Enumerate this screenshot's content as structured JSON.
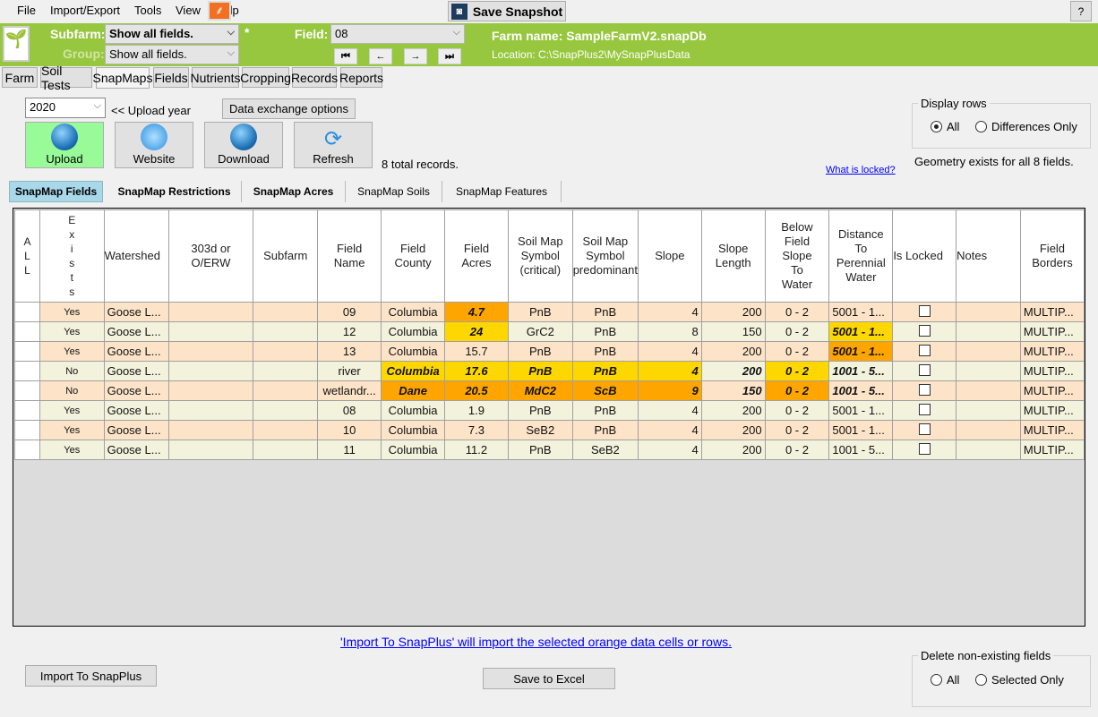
{
  "menu": [
    "File",
    "Import/Export",
    "Tools",
    "View",
    "Help"
  ],
  "snapshot_label": "Save Snapshot",
  "help_label": "?",
  "header": {
    "subfarm_label": "Subfarm:",
    "subfarm_value": "Show all fields.",
    "group_label": "Group:",
    "group_value": "Show all fields.",
    "asterisk": "*",
    "field_label": "Field:",
    "field_value": "08",
    "farm_name": "Farm name: SampleFarmV2.snapDb",
    "location": "Location: C:\\SnapPlus2\\MySnapPlusData",
    "nav": [
      "⏮",
      "←",
      "→",
      "⏭"
    ]
  },
  "tabs": [
    "Farm",
    "Soil Tests",
    "SnapMaps",
    "Fields",
    "Nutrients",
    "Cropping",
    "Records",
    "Reports"
  ],
  "active_tab": "SnapMaps",
  "year": "2020",
  "upload_year_label": "<< Upload year",
  "data_exchange_label": "Data exchange options",
  "actions": [
    "Upload",
    "Website",
    "Download",
    "Refresh"
  ],
  "total_records": "8 total records.",
  "what_locked": "What is locked?",
  "display_rows": {
    "title": "Display rows",
    "options": [
      "All",
      "Differences Only"
    ],
    "selected": "All"
  },
  "geometry_text": "Geometry exists for all 8 fields.",
  "subtabs": [
    "SnapMap Fields",
    "SnapMap Restrictions",
    "SnapMap Acres",
    "SnapMap Soils",
    "SnapMap Features"
  ],
  "active_subtab": "SnapMap Fields",
  "colors": {
    "orange": "#ffa500",
    "yellow": "#ffd700",
    "row_odd": "#fde4c8",
    "row_even": "#f3f2dd",
    "header_green": "#97c73e"
  },
  "table": {
    "columns": [
      "A\nL\nL",
      "E\nx\ni\ns\nt\ns",
      "Watershed",
      "303d or\nO/ERW",
      "Subfarm",
      "Field\nName",
      "Field\nCounty",
      "Field\nAcres",
      "Soil Map\nSymbol\n(critical)",
      "Soil Map\nSymbol\npredominant",
      "Slope",
      "Slope\nLength",
      "Below\nField\nSlope\nTo\nWater",
      "Distance\nTo\nPerennial\nWater",
      "Is Locked",
      "Notes",
      "Field\nBorders"
    ],
    "rows": [
      {
        "cells": [
          "",
          "Yes",
          "Goose L...",
          "",
          "",
          "09",
          "Columbia",
          "4.7",
          "PnB",
          "PnB",
          "4",
          "200",
          "0 - 2",
          "5001 - 1...",
          "",
          "",
          "MULTIP..."
        ],
        "hl": {
          "7": "o"
        }
      },
      {
        "cells": [
          "",
          "Yes",
          "Goose L...",
          "",
          "",
          "12",
          "Columbia",
          "24",
          "GrC2",
          "PnB",
          "8",
          "150",
          "0 - 2",
          "5001 - 1...",
          "",
          "",
          "MULTIP..."
        ],
        "hl": {
          "7": "y",
          "13": "y"
        }
      },
      {
        "cells": [
          "",
          "Yes",
          "Goose L...",
          "",
          "",
          "13",
          "Columbia",
          "15.7",
          "PnB",
          "PnB",
          "4",
          "200",
          "0 - 2",
          "5001 - 1...",
          "",
          "",
          "MULTIP..."
        ],
        "hl": {
          "13": "o"
        }
      },
      {
        "cells": [
          "",
          "No",
          "Goose L...",
          "",
          "",
          "river",
          "Columbia",
          "17.6",
          "PnB",
          "PnB",
          "4",
          "200",
          "0 - 2",
          "1001 - 5...",
          "",
          "",
          "MULTIP..."
        ],
        "hl": {
          "6": "y",
          "7": "y",
          "8": "y",
          "9": "y",
          "10": "y",
          "11": "b",
          "12": "y",
          "13": "b"
        }
      },
      {
        "cells": [
          "",
          "No",
          "Goose L...",
          "",
          "",
          "wetlandr...",
          "Dane",
          "20.5",
          "MdC2",
          "ScB",
          "9",
          "150",
          "0 - 2",
          "1001 - 5...",
          "",
          "",
          "MULTIP..."
        ],
        "hl": {
          "6": "o",
          "7": "o",
          "8": "o",
          "9": "o",
          "10": "o",
          "11": "b",
          "12": "o",
          "13": "b"
        }
      },
      {
        "cells": [
          "",
          "Yes",
          "Goose L...",
          "",
          "",
          "08",
          "Columbia",
          "1.9",
          "PnB",
          "PnB",
          "4",
          "200",
          "0 - 2",
          "5001 - 1...",
          "",
          "",
          "MULTIP..."
        ],
        "hl": {}
      },
      {
        "cells": [
          "",
          "Yes",
          "Goose L...",
          "",
          "",
          "10",
          "Columbia",
          "7.3",
          "SeB2",
          "PnB",
          "4",
          "200",
          "0 - 2",
          "5001 - 1...",
          "",
          "",
          "MULTIP..."
        ],
        "hl": {}
      },
      {
        "cells": [
          "",
          "Yes",
          "Goose L...",
          "",
          "",
          "11",
          "Columbia",
          "11.2",
          "PnB",
          "SeB2",
          "4",
          "200",
          "0 - 2",
          "1001 - 5...",
          "",
          "",
          "MULTIP..."
        ],
        "hl": {}
      }
    ],
    "locked": [
      false,
      false,
      false,
      false,
      false,
      false,
      false,
      false
    ]
  },
  "import_note": "'Import To SnapPlus' will import the selected orange data cells or rows.",
  "import_button": "Import To SnapPlus",
  "excel_button": "Save to Excel",
  "delete_group": {
    "title": "Delete non-existing fields",
    "options": [
      "All",
      "Selected Only"
    ]
  }
}
